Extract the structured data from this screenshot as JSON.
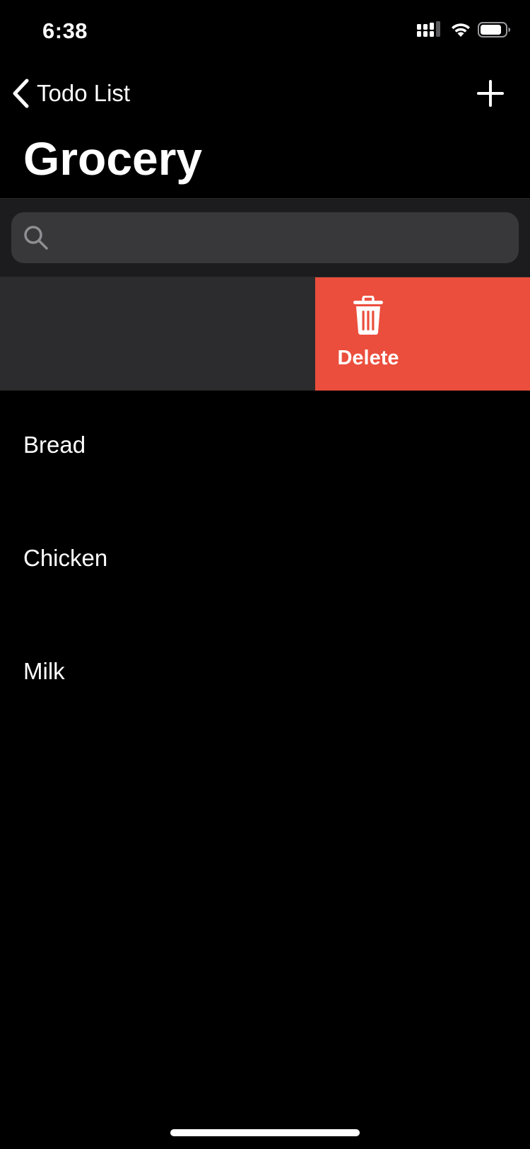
{
  "status_bar": {
    "time": "6:38",
    "icons": [
      "signal-icon",
      "wifi-icon",
      "battery-icon"
    ]
  },
  "nav": {
    "back_label": "Todo List",
    "back_icon": "chevron-left-icon",
    "add_icon": "plus-icon"
  },
  "page": {
    "title": "Grocery"
  },
  "search": {
    "icon": "search-icon",
    "value": "",
    "placeholder": ""
  },
  "swipe_action": {
    "label": "Delete",
    "icon": "trash-icon",
    "color": "#eb4e3d"
  },
  "list": {
    "items": [
      {
        "label": "Bread"
      },
      {
        "label": "Chicken"
      },
      {
        "label": "Milk"
      }
    ]
  },
  "colors": {
    "background": "#000000",
    "search_section": "#1c1c1e",
    "search_field": "#38383a",
    "swiped_row": "#2c2c2e",
    "destructive": "#eb4e3d"
  }
}
